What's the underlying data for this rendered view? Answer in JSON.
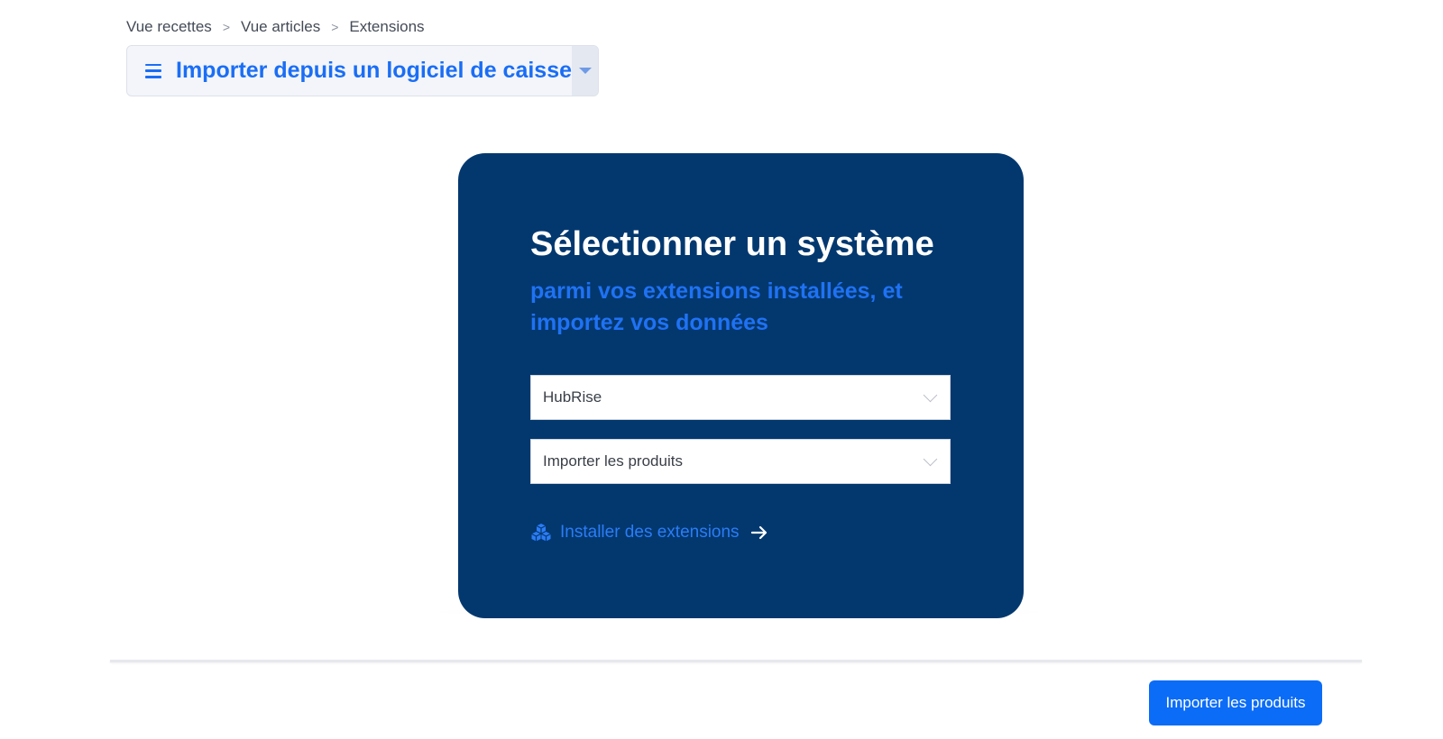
{
  "breadcrumb": {
    "items": [
      "Vue recettes",
      "Vue articles",
      "Extensions"
    ],
    "separator": ">"
  },
  "header": {
    "title": "Importer depuis un logiciel de caisse",
    "menu_icon": "hamburger-icon",
    "dropdown_icon": "caret-down-icon"
  },
  "card": {
    "title": "Sélectionner un système",
    "subtitle": "parmi vos extensions installées, et importez vos données",
    "system_select": {
      "value": "HubRise"
    },
    "action_select": {
      "value": "Importer les produits"
    },
    "install_link": {
      "label": "Installer des extensions",
      "icon": "cubes-icon",
      "arrow_icon": "arrow-right-icon"
    }
  },
  "footer": {
    "primary_button": "Importer les produits"
  },
  "colors": {
    "accent": "#1a6ef5",
    "card_background": "#03386f",
    "primary_button": "#0b6cf7",
    "white": "#ffffff"
  }
}
